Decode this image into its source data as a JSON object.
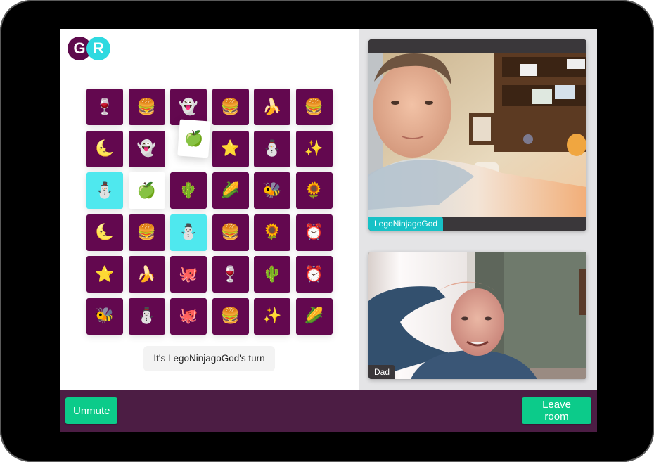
{
  "logo": {
    "left_letter": "G",
    "right_letter": "R"
  },
  "colors": {
    "tile_back": "#63084f",
    "tile_matched": "#4fe8ee",
    "tile_revealed": "#ffffff",
    "footer": "#4c1d44",
    "button": "#0ccb8a",
    "active_name_tag": "#17c1c6"
  },
  "board": {
    "rows": 6,
    "cols": 6,
    "tiles": [
      {
        "icon": "wine-glass-icon",
        "glyph": "🍷",
        "state": "face-up"
      },
      {
        "icon": "hamburger-icon",
        "glyph": "🍔",
        "state": "face-up"
      },
      {
        "icon": "ghost-icon",
        "glyph": "👻",
        "state": "face-up"
      },
      {
        "icon": "hamburger-icon",
        "glyph": "🍔",
        "state": "face-up"
      },
      {
        "icon": "banana-icon",
        "glyph": "🍌",
        "state": "face-up"
      },
      {
        "icon": "hamburger-icon",
        "glyph": "🍔",
        "state": "face-up"
      },
      {
        "icon": "crescent-moon-face-icon",
        "glyph": "🌜",
        "state": "face-up"
      },
      {
        "icon": "ghost-icon",
        "glyph": "👻",
        "state": "face-up"
      },
      {
        "icon": "green-apple-icon",
        "glyph": "🍏",
        "state": "flipping"
      },
      {
        "icon": "star-icon",
        "glyph": "⭐",
        "state": "face-up"
      },
      {
        "icon": "snowman-icon",
        "glyph": "⛄",
        "state": "face-up"
      },
      {
        "icon": "sparkles-icon",
        "glyph": "✨",
        "state": "face-up"
      },
      {
        "icon": "snowman-icon",
        "glyph": "⛄",
        "state": "matched"
      },
      {
        "icon": "green-apple-icon",
        "glyph": "🍏",
        "state": "revealed"
      },
      {
        "icon": "cactus-icon",
        "glyph": "🌵",
        "state": "face-up"
      },
      {
        "icon": "corn-icon",
        "glyph": "🌽",
        "state": "face-up"
      },
      {
        "icon": "bee-icon",
        "glyph": "🐝",
        "state": "face-up"
      },
      {
        "icon": "sunflower-icon",
        "glyph": "🌻",
        "state": "face-up"
      },
      {
        "icon": "crescent-moon-face-icon",
        "glyph": "🌜",
        "state": "face-up"
      },
      {
        "icon": "hamburger-icon",
        "glyph": "🍔",
        "state": "face-up"
      },
      {
        "icon": "snowman-icon",
        "glyph": "⛄",
        "state": "matched"
      },
      {
        "icon": "hamburger-icon",
        "glyph": "🍔",
        "state": "face-up"
      },
      {
        "icon": "sunflower-icon",
        "glyph": "🌻",
        "state": "face-up"
      },
      {
        "icon": "alarm-clock-icon",
        "glyph": "⏰",
        "state": "face-up"
      },
      {
        "icon": "star-icon",
        "glyph": "⭐",
        "state": "face-up"
      },
      {
        "icon": "banana-icon",
        "glyph": "🍌",
        "state": "face-up"
      },
      {
        "icon": "octopus-icon",
        "glyph": "🐙",
        "state": "face-up"
      },
      {
        "icon": "wine-glass-icon",
        "glyph": "🍷",
        "state": "face-up"
      },
      {
        "icon": "cactus-icon",
        "glyph": "🌵",
        "state": "face-up"
      },
      {
        "icon": "alarm-clock-icon",
        "glyph": "⏰",
        "state": "face-up"
      },
      {
        "icon": "bee-icon",
        "glyph": "🐝",
        "state": "face-up"
      },
      {
        "icon": "snowman-icon",
        "glyph": "⛄",
        "state": "face-up"
      },
      {
        "icon": "octopus-icon",
        "glyph": "🐙",
        "state": "face-up"
      },
      {
        "icon": "hamburger-icon",
        "glyph": "🍔",
        "state": "face-up"
      },
      {
        "icon": "sparkles-icon",
        "glyph": "✨",
        "state": "face-up"
      },
      {
        "icon": "corn-icon",
        "glyph": "🌽",
        "state": "face-up"
      }
    ]
  },
  "status": {
    "turn_text": "It's LegoNinjagoGod's turn"
  },
  "participants": [
    {
      "name": "LegoNinjagoGod",
      "active": true
    },
    {
      "name": "Dad",
      "active": false
    }
  ],
  "footer": {
    "unmute_label": "Unmute",
    "leave_label": "Leave room"
  }
}
